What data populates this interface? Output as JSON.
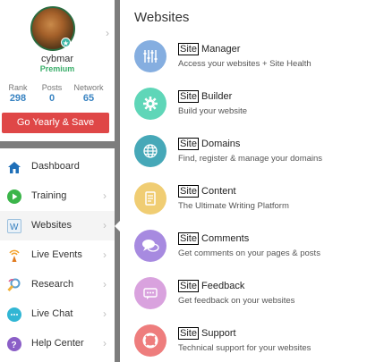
{
  "profile": {
    "username": "cybmar",
    "plan": "Premium",
    "stats": [
      {
        "label": "Rank",
        "value": "298"
      },
      {
        "label": "Posts",
        "value": "0"
      },
      {
        "label": "Network",
        "value": "65"
      }
    ],
    "cta": "Go Yearly & Save"
  },
  "nav": {
    "items": [
      {
        "label": "Dashboard",
        "icon": "home-icon"
      },
      {
        "label": "Training",
        "icon": "play-icon"
      },
      {
        "label": "Websites",
        "icon": "website-icon"
      },
      {
        "label": "Live Events",
        "icon": "broadcast-icon"
      },
      {
        "label": "Research",
        "icon": "research-icon"
      },
      {
        "label": "Live Chat",
        "icon": "chat-icon"
      },
      {
        "label": "Help Center",
        "icon": "help-icon"
      }
    ]
  },
  "panel": {
    "title": "Websites",
    "items": [
      {
        "prefix": "Site",
        "label": " Manager",
        "desc": "Access your websites + Site Health",
        "icon": "sliders-icon",
        "color": "#85aee0"
      },
      {
        "prefix": "Site",
        "label": " Builder",
        "desc": "Build your website",
        "icon": "gear-icon",
        "color": "#5fd6b8"
      },
      {
        "prefix": "Site",
        "label": " Domains",
        "desc": "Find, register & manage your domains",
        "icon": "globe-icon",
        "color": "#46a8b8"
      },
      {
        "prefix": "Site",
        "label": " Content",
        "desc": "The Ultimate Writing Platform",
        "icon": "document-icon",
        "color": "#f0cd73"
      },
      {
        "prefix": "Site",
        "label": " Comments",
        "desc": "Get comments on your pages & posts",
        "icon": "comments-icon",
        "color": "#a78ae0"
      },
      {
        "prefix": "Site",
        "label": " Feedback",
        "desc": "Get feedback on your websites",
        "icon": "feedback-icon",
        "color": "#d9a2de"
      },
      {
        "prefix": "Site",
        "label": " Support",
        "desc": "Technical support for your websites",
        "icon": "lifebuoy-icon",
        "color": "#ee7d7d"
      }
    ]
  }
}
